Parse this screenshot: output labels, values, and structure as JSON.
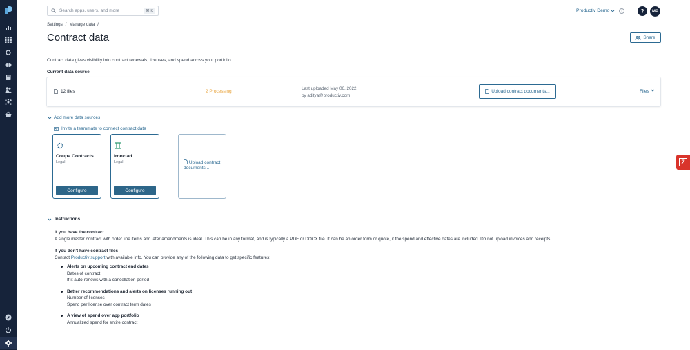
{
  "topbar": {
    "search_placeholder": "Search apps, users, and more",
    "search_shortcut": "⌘ K",
    "org_name": "Productiv Demo",
    "help_label": "?",
    "avatar_initials": "MP"
  },
  "breadcrumb": [
    "Settings",
    "/",
    "Manage data",
    "/"
  ],
  "page": {
    "title": "Contract data",
    "share_label": "Share",
    "description": "Contract data gives visibility into contract renewals, licenses, and spend across your portfolio.",
    "current_source_label": "Current data source"
  },
  "current_source": {
    "files": "12 files",
    "processing": "2 Processing",
    "last_uploaded": "Last uploaded May 06, 2022",
    "uploaded_by": "by aditya@productiv.com",
    "upload_button": "Upload contract documents...",
    "files_menu": "Files"
  },
  "add_sources": {
    "toggle_label": "Add more data sources",
    "invite_label": "Invite a teammate to connect contract data",
    "sources": [
      {
        "name": "Coupa Contracts",
        "category": "Legal",
        "button": "Configure"
      },
      {
        "name": "Ironclad",
        "category": "Legal",
        "button": "Configure"
      }
    ],
    "upload_tile_label": "Upload contract documents..."
  },
  "instructions": {
    "header": "Instructions",
    "have_title": "If you have the contract",
    "have_text": "A single master contract with order line items and later amendments is ideal. This can be in any format, and is typically a PDF or DOCX file. It can be an order form or quote, if the spend and effective dates are included. Do not upload invoices and receipts.",
    "dont_have_title": "If you don't have contract files",
    "dont_have_pre": "Contact ",
    "dont_have_link": "Productiv support",
    "dont_have_post": " with available info. You can provide any of the following data to get specific features:",
    "bullets": [
      {
        "title": "Alerts on upcoming contract end dates",
        "lines": [
          "Dates of contract",
          "If it auto-renews with a cancellation period"
        ]
      },
      {
        "title": "Better recommendations and alerts on licenses running out",
        "lines": [
          "Number of licenses",
          "Spend per license over contract term dates"
        ]
      },
      {
        "title": "A view of spend over app portfolio",
        "lines": [
          "Annualized spend for entire contract"
        ]
      }
    ]
  },
  "colors": {
    "sidebar": "#16233a",
    "accent": "#2c6a92",
    "processing": "#e8a33b",
    "button": "#2d6689"
  }
}
